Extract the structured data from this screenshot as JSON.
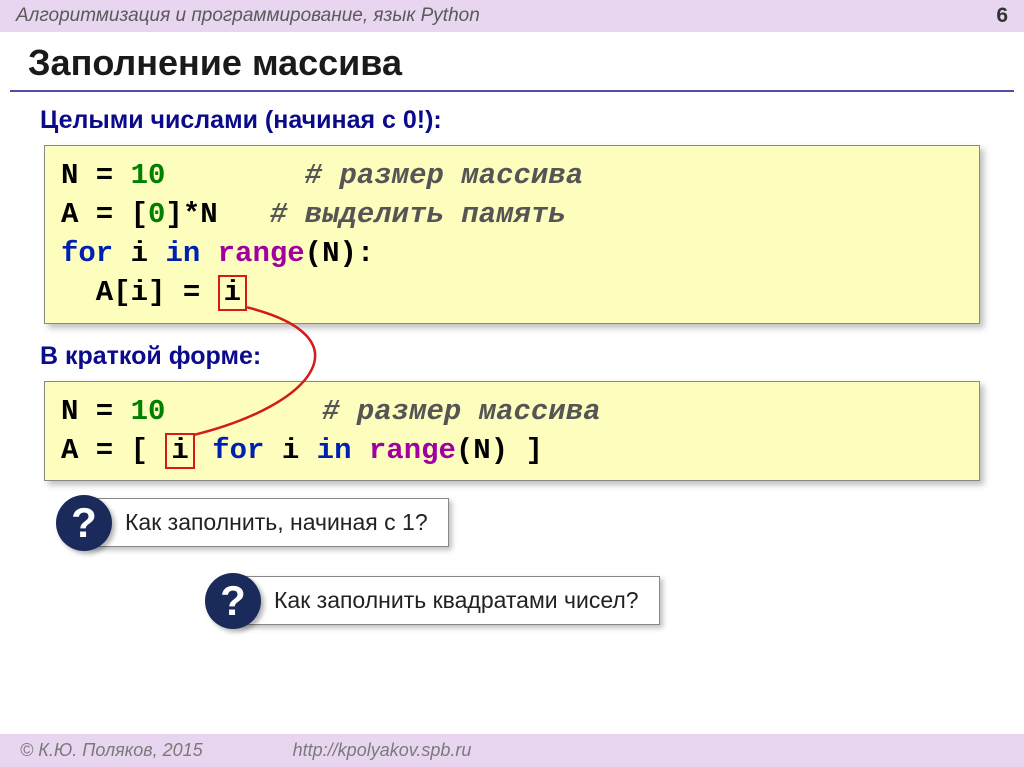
{
  "header": {
    "title": "Алгоритмизация и программирование, язык Python",
    "page": "6"
  },
  "title": "Заполнение массива",
  "sub1": "Целыми числами (начиная с 0!):",
  "code1": {
    "l1a": "N = ",
    "l1b": "10",
    "l1c": "        # размер массива",
    "l2a": "A = [",
    "l2b": "0",
    "l2c": "]*N   ",
    "l2d": "# выделить память",
    "l3a": "for",
    "l3b": " i ",
    "l3c": "in",
    "l3d": " ",
    "l3e": "range",
    "l3f": "(N):",
    "l4a": "  A[i] = ",
    "l4b": "i"
  },
  "sub2": "В краткой форме:",
  "code2": {
    "l1a": "N = ",
    "l1b": "10",
    "l1c": "         # размер массива",
    "l2a": "A = [ ",
    "l2b": "i",
    "l2c": " ",
    "l2d": "for",
    "l2e": " i ",
    "l2f": "in",
    "l2g": " ",
    "l2h": "range",
    "l2i": "(N) ]"
  },
  "q1": "Как заполнить, начиная с 1?",
  "q2": "Как заполнить квадратами чисел?",
  "qmark": "?",
  "footer": {
    "copyright": "© К.Ю. Поляков, 2015",
    "url": "http://kpolyakov.spb.ru"
  }
}
